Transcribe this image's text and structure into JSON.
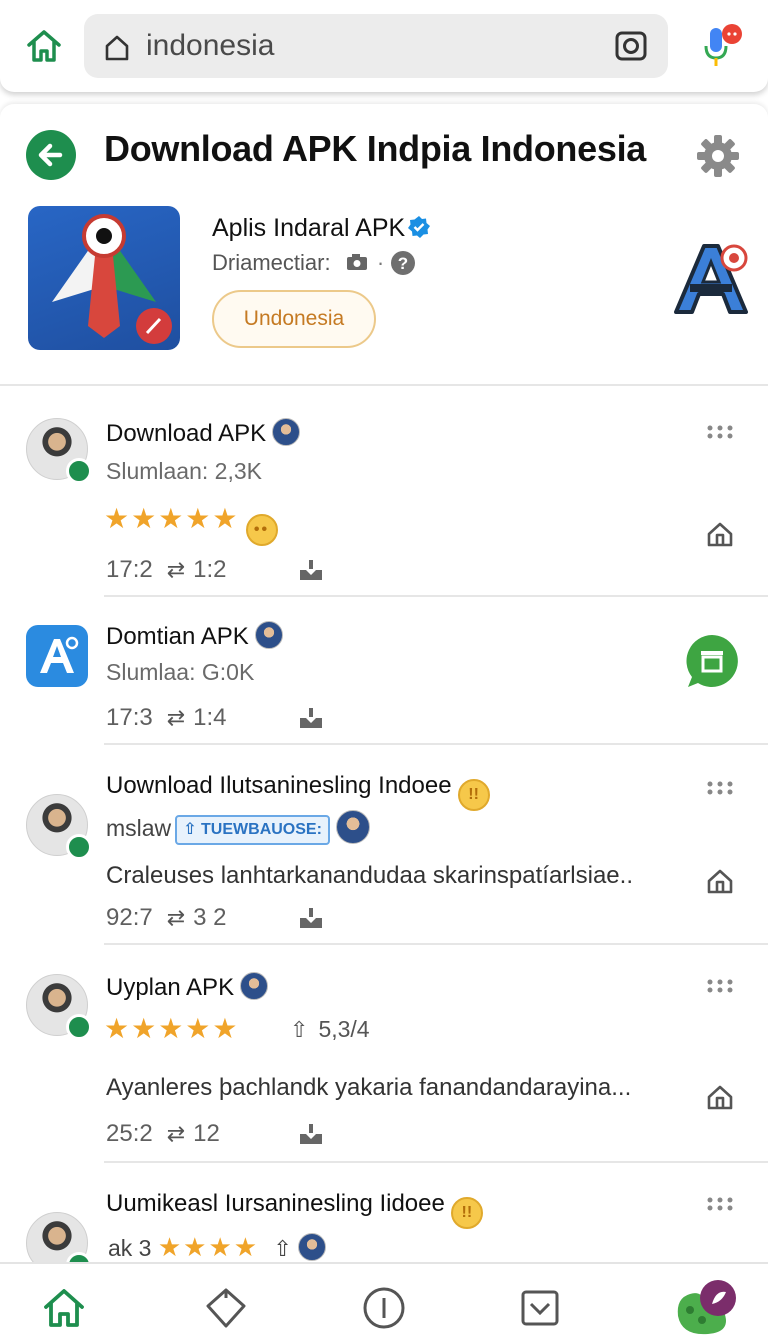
{
  "browser": {
    "url_text": "indonesia",
    "icons": {
      "home": "home-icon",
      "lock": "lock-icon",
      "camera": "camera-icon",
      "mic": "mic-icon"
    }
  },
  "header": {
    "title": "Download APK Indpia Indonesia",
    "back_icon": "back-arrow-icon",
    "settings_icon": "gear-icon"
  },
  "app": {
    "name": "Aplis Indaral APK",
    "developer_label": "Driamectiar:",
    "chip_label": "Undonesia",
    "brand_icon": "brand-a-icon"
  },
  "feed": [
    {
      "title": "Download APK",
      "subtitle": "Slumlaan: 2,3K",
      "stars": "★★★★★",
      "meta_left": "17:2",
      "meta_right": "1:2"
    },
    {
      "title": "Domtian APK",
      "subtitle": "Slumlaa: G:0K",
      "meta_left": "17:3",
      "meta_right": "1:4"
    },
    {
      "title": "Uownload Ilutsaninesling Indoee",
      "subtitle": "mslaw",
      "tag": "TUEWBAUOSE:",
      "description": "Craleuses lanhtarkanandudaa skarinspatíarlsiae..",
      "meta_left": "92:7",
      "meta_right": "3 2"
    },
    {
      "title": "Uyplan APK",
      "stars": "★★★★★",
      "count": "5,3/4",
      "description": "Ayanleres þachlandk  yakaria fanandandarayina...",
      "meta_left": "25:2",
      "meta_right": "12"
    },
    {
      "title": "Uumikeasl Iursaninesling Iidoee",
      "subtitle": "ak 3",
      "stars": "★★★★"
    }
  ],
  "bottom_nav": [
    "home-icon",
    "tag-icon",
    "info-icon",
    "inbox-icon",
    "profile-icon"
  ],
  "colors": {
    "accent_green": "#1e8e4e",
    "star": "#f0a42a",
    "chip_orange": "#c57a23",
    "link_blue": "#2b73c2"
  }
}
